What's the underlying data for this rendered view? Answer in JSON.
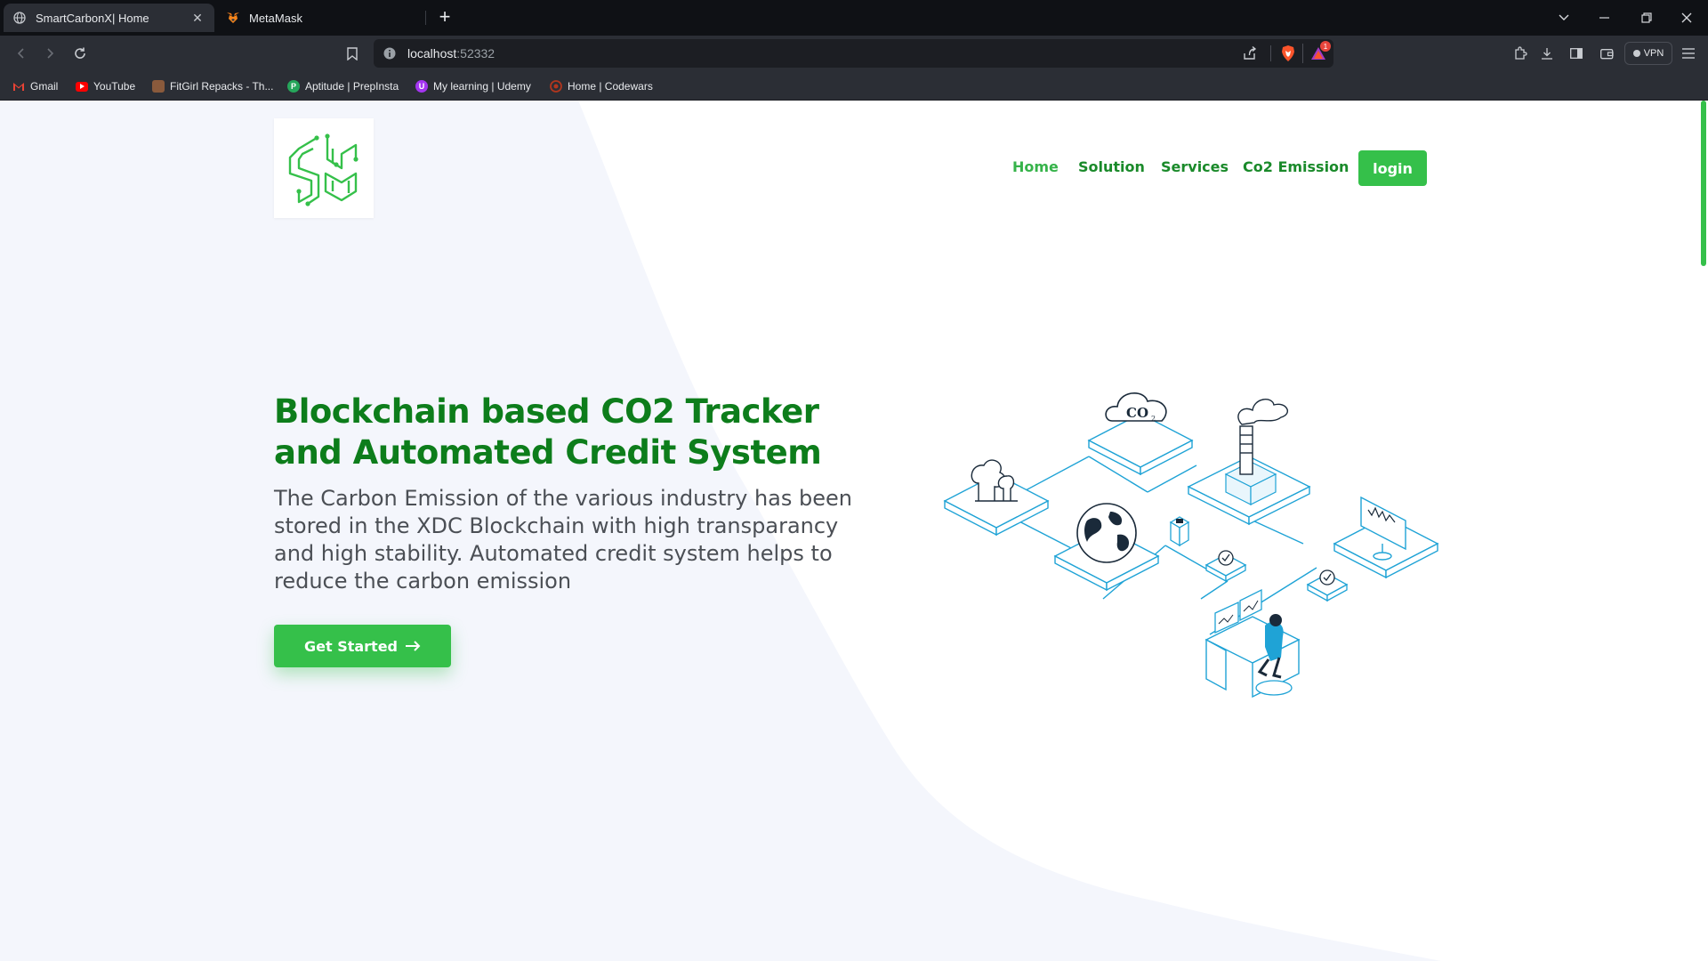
{
  "browser": {
    "tabs": [
      {
        "title": "SmartCarbonX| Home",
        "active": true,
        "icon": "globe-icon"
      },
      {
        "title": "MetaMask",
        "active": false,
        "icon": "metamask-fox-icon"
      }
    ],
    "address": {
      "host": "localhost",
      "port": ":52332"
    },
    "vpn_label": "VPN",
    "notification_count": "1",
    "bookmarks": [
      {
        "label": "Gmail",
        "icon": "gmail-icon",
        "color": "#ea4335"
      },
      {
        "label": "YouTube",
        "icon": "youtube-icon",
        "color": "#ff0000"
      },
      {
        "label": "FitGirl Repacks - Th...",
        "icon": "fitgirl-icon",
        "color": "#8a5a3c"
      },
      {
        "label": "Aptitude | PrepInsta",
        "icon": "prepinsta-icon",
        "color": "#26a65b"
      },
      {
        "label": "My learning | Udemy",
        "icon": "udemy-icon",
        "color": "#a435f0"
      },
      {
        "label": "Home | Codewars",
        "icon": "codewars-icon",
        "color": "#b1361e"
      }
    ]
  },
  "site": {
    "brand_color": "#35c04a",
    "title_color": "#0d7d1b",
    "nav": [
      {
        "label": "Home",
        "active": true
      },
      {
        "label": "Solution",
        "active": false
      },
      {
        "label": "Services",
        "active": false
      },
      {
        "label": "Co2 Emission",
        "active": false
      }
    ],
    "login_label": "login",
    "hero": {
      "title": "Blockchain based CO2 Tracker and Automated Credit System",
      "description": "The Carbon Emission of the various industry has been stored in the XDC Blockchain with high transparancy and high stability. Automated credit system helps to reduce the carbon emission",
      "cta_label": "Get Started",
      "cta_icon": "arrow-right-icon"
    },
    "illustration": {
      "co2_label": "CO",
      "co2_subscript": "2",
      "stroke_color": "#1fa3d6"
    }
  }
}
